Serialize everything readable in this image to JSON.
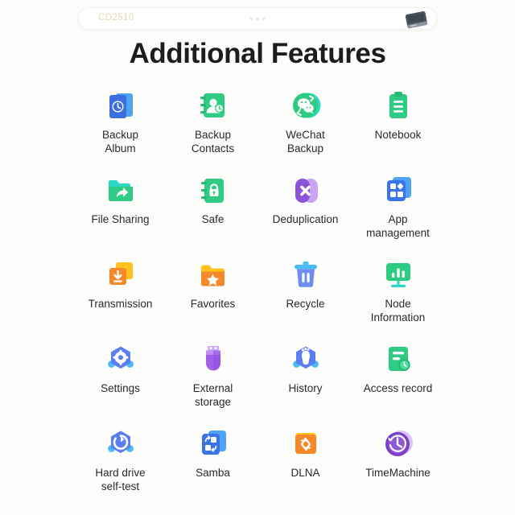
{
  "header": {
    "device_name": "CD2510",
    "device_icon": "external-ssd-icon",
    "dots": [
      "dot",
      "dot",
      "dot"
    ]
  },
  "title": "Additional Features",
  "colors": {
    "background": "#fdfdfc",
    "title_text": "#1d1d1d",
    "label_text": "#2a2a2a",
    "device_name_text": "#e4d9b7",
    "blue": "#3b74e8",
    "light_blue": "#4da3f5",
    "green": "#2ecc82",
    "teal": "#2bd8c6",
    "purple": "#8c52d8",
    "light_purple": "#b98df0",
    "orange": "#f5892a",
    "yellow": "#ffc21f"
  },
  "features": [
    {
      "label": "Backup\nAlbum",
      "icon": "backup-album-icon"
    },
    {
      "label": "Backup\nContacts",
      "icon": "backup-contacts-icon"
    },
    {
      "label": "WeChat\nBackup",
      "icon": "wechat-backup-icon"
    },
    {
      "label": "Notebook",
      "icon": "notebook-icon"
    },
    {
      "label": "File Sharing",
      "icon": "file-sharing-icon"
    },
    {
      "label": "Safe",
      "icon": "safe-icon"
    },
    {
      "label": "Deduplication",
      "icon": "deduplication-icon"
    },
    {
      "label": "App\nmanagement",
      "icon": "app-management-icon"
    },
    {
      "label": "Transmission",
      "icon": "transmission-icon"
    },
    {
      "label": "Favorites",
      "icon": "favorites-icon"
    },
    {
      "label": "Recycle",
      "icon": "recycle-icon"
    },
    {
      "label": "Node\nInformation",
      "icon": "node-information-icon"
    },
    {
      "label": "Settings",
      "icon": "settings-icon"
    },
    {
      "label": "External\nstorage",
      "icon": "external-storage-icon"
    },
    {
      "label": "History",
      "icon": "history-icon"
    },
    {
      "label": "Access record",
      "icon": "access-record-icon"
    },
    {
      "label": "Hard drive\nself-test",
      "icon": "hard-drive-self-test-icon"
    },
    {
      "label": "Samba",
      "icon": "samba-icon"
    },
    {
      "label": "DLNA",
      "icon": "dlna-icon"
    },
    {
      "label": "TimeMachine",
      "icon": "timemachine-icon"
    }
  ]
}
